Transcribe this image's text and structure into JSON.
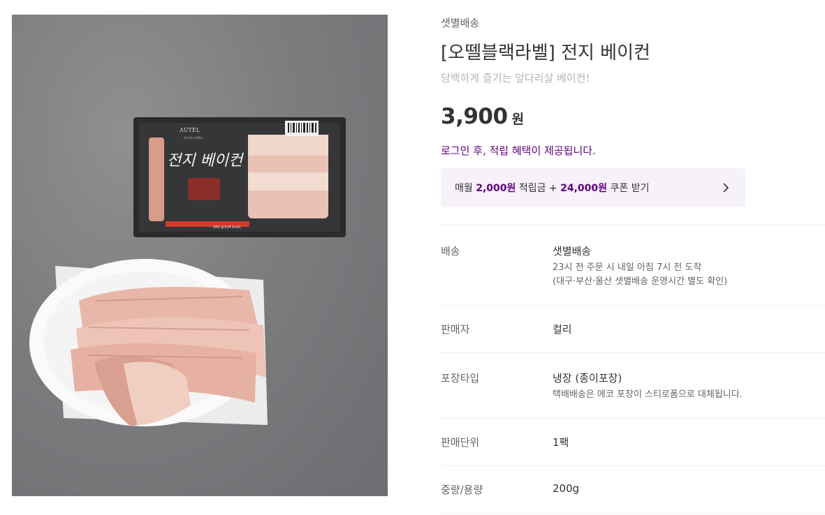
{
  "product": {
    "delivery_tag": "샛별배송",
    "name": "[오뗄블랙라벨] 전지 베이컨",
    "subtitle": "담백하게 즐기는 앞다리살 베이컨!",
    "price": "3,900",
    "price_unit": "원",
    "login_notice": "로그인 후, 적립 혜택이 제공됩니다.",
    "image_alt": "bacon-product-photo"
  },
  "coupon": {
    "prefix": "매월 ",
    "points": "2,000원",
    "middle": " 적립금 + ",
    "coupon_amount": "24,000원",
    "suffix": " 쿠폰 받기",
    "arrow_icon": "chevron-right-icon"
  },
  "package_text": {
    "brand": "AUTEL",
    "sublabel": "BLACK LABEL",
    "title": "전지 베이컨",
    "weight": "200 g(524 kcal)"
  },
  "details": [
    {
      "label": "배송",
      "value": "샛별배송",
      "notes": [
        "23시 전 주문 시 내일 아침 7시 전 도착",
        "(대구·부산·울산 샛별배송 운영시간 별도 확인)"
      ]
    },
    {
      "label": "판매자",
      "value": "컬리",
      "notes": []
    },
    {
      "label": "포장타입",
      "value": "냉장 (종이포장)",
      "notes": [
        "택배배송은 에코 포장이 스티로폼으로 대체됩니다."
      ]
    },
    {
      "label": "판매단위",
      "value": "1팩",
      "notes": []
    },
    {
      "label": "중량/용량",
      "value": "200g",
      "notes": []
    }
  ],
  "colors": {
    "brand_purple": "#5f0080",
    "coupon_bg": "#f7f1fa",
    "divider": "#f0f0f0"
  }
}
